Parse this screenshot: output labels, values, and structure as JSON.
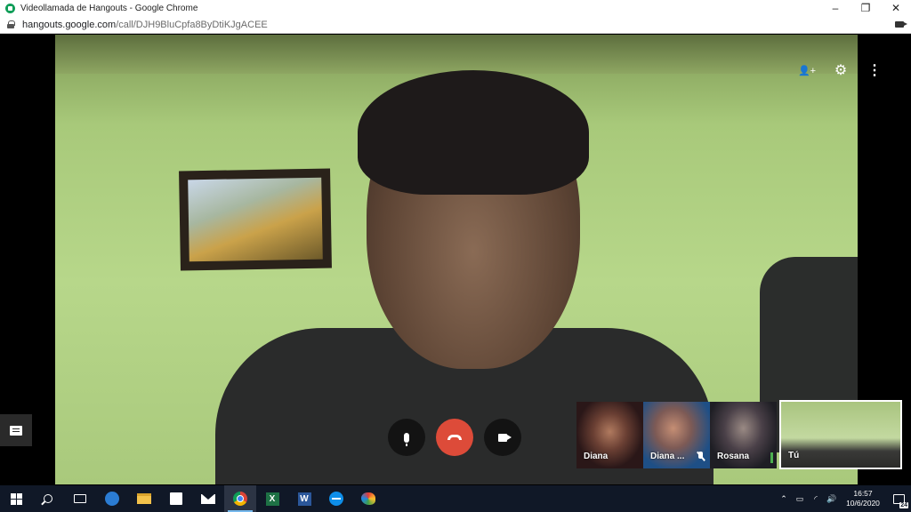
{
  "window": {
    "title": "Videollamada de Hangouts - Google Chrome",
    "controls": {
      "minimize": "–",
      "maximize": "❐",
      "close": "✕"
    }
  },
  "address": {
    "host": "hangouts.google.com",
    "path": "/call/DJH9BluCpfa8ByDtiKJgACEE"
  },
  "call": {
    "top_icons": [
      "add-person-icon",
      "settings-gear-icon",
      "more-vert-icon"
    ],
    "top_glyphs": {
      "add_person": "👤+",
      "settings": "⚙",
      "more": "⋮"
    },
    "controls": [
      "microphone",
      "hang-up",
      "camera"
    ],
    "participants": [
      {
        "name": "Diana",
        "muted": false
      },
      {
        "name": "Diana ...",
        "muted": true
      },
      {
        "name": "Rosana",
        "muted": false
      }
    ],
    "self_label": "Tú",
    "colors": {
      "hangup": "#dd4b39",
      "video_wall": "#b7d78a"
    }
  },
  "taskbar": {
    "apps": [
      "start",
      "search",
      "task-view",
      "edge",
      "file-explorer",
      "store",
      "mail",
      "chrome",
      "excel",
      "word",
      "teamviewer",
      "paint"
    ],
    "excel_letter": "X",
    "word_letter": "W",
    "tray_glyphs": {
      "chevron": "⌃",
      "battery": "▭",
      "wifi": "◜",
      "volume": "🔊"
    },
    "clock_time": "16:57",
    "clock_date": "10/6/2020",
    "notification_count": "24"
  }
}
